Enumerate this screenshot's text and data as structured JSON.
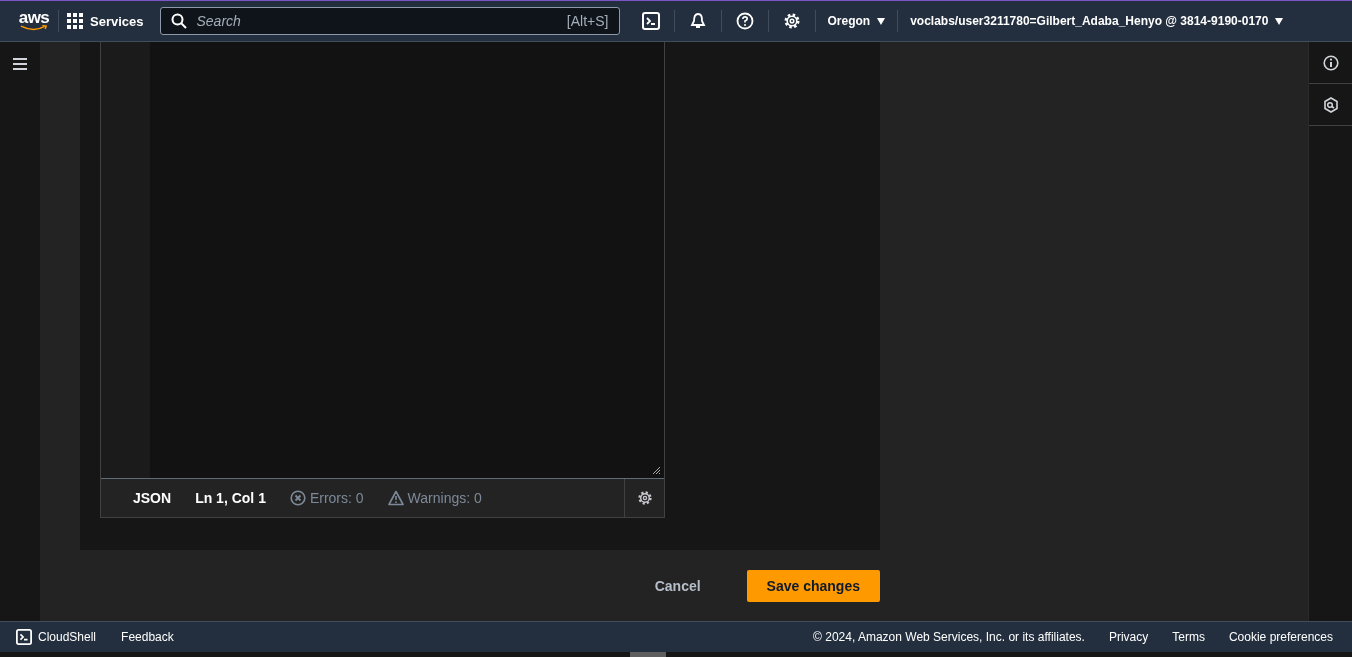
{
  "top_bar": {
    "logo": "aws",
    "services": "Services",
    "search": {
      "placeholder": "Search",
      "shortcut": "[Alt+S]"
    },
    "region": "Oregon",
    "account": "voclabs/user3211780=Gilbert_Adaba_Henyo @ 3814-9190-0170"
  },
  "editor": {
    "status_bar": {
      "language": "JSON",
      "position": "Ln 1, Col 1",
      "errors": "Errors: 0",
      "warnings": "Warnings: 0"
    }
  },
  "buttons": [
    {
      "label": "Cancel",
      "kind": "secondary"
    },
    {
      "label": "Save changes",
      "kind": "primary"
    }
  ],
  "footer": {
    "cloudshell": "CloudShell",
    "feedback": "Feedback",
    "copyright": "© 2024, Amazon Web Services, Inc. or its affiliates.",
    "links": [
      "Privacy",
      "Terms",
      "Cookie preferences"
    ]
  }
}
